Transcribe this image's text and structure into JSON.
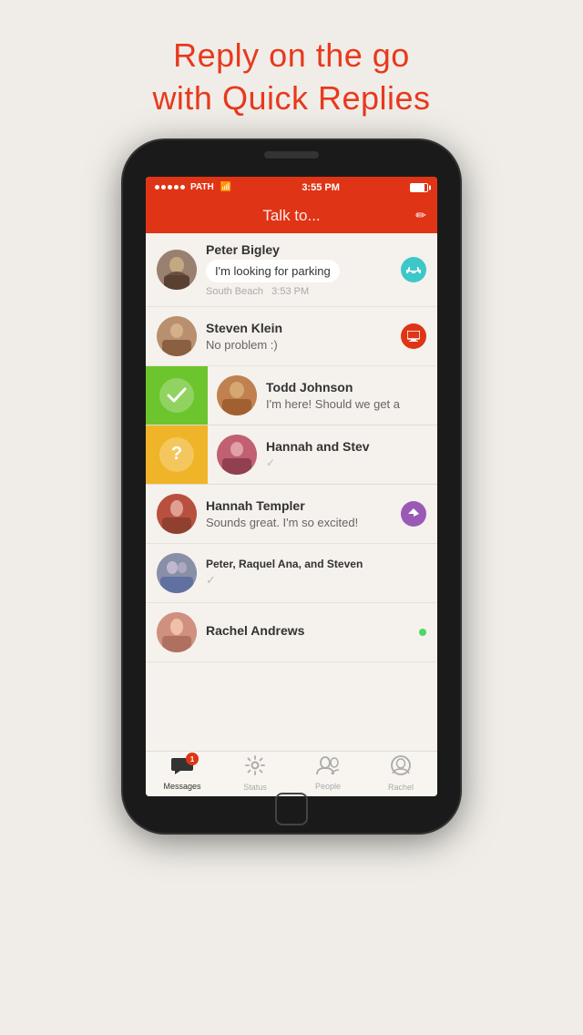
{
  "headline": {
    "line1": "Reply on the go",
    "line2": "with Quick Replies"
  },
  "status_bar": {
    "carrier": "PATH",
    "time": "3:55 PM"
  },
  "nav_bar": {
    "title": "Talk to...",
    "edit_icon": "✏"
  },
  "messages": [
    {
      "id": "peter-bigley",
      "sender": "Peter Bigley",
      "bubble": "I'm looking for parking",
      "sub": "South Beach  3:53 PM",
      "badge_type": "car",
      "badge_icon": "🚗",
      "avatar_color": "#9a8a7a",
      "action": null
    },
    {
      "id": "steven-klein",
      "sender": "Steven Klein",
      "preview": "No problem :)",
      "badge_type": "screen",
      "badge_icon": "⬜",
      "avatar_color": "#c4a882",
      "action": null
    },
    {
      "id": "todd-johnson",
      "sender": "Todd Johnson",
      "preview": "I'm here! Should we get a",
      "avatar_color": "#c88860",
      "action": "green",
      "action_icon": "✓"
    },
    {
      "id": "hannah-steve",
      "sender": "Hannah and Stev",
      "preview": "✓",
      "avatar_color": "#d06070",
      "action": "yellow",
      "action_icon": "?"
    },
    {
      "id": "hannah-templer",
      "sender": "Hannah Templer",
      "preview": "Sounds great. I'm so excited!",
      "badge_type": "nav",
      "badge_icon": "➤",
      "avatar_color": "#c85040",
      "action": null
    },
    {
      "id": "group-peter",
      "sender": "Peter, Raquel Ana, and Steven",
      "preview": "✓",
      "avatar_color": "#8890a8",
      "action": null
    },
    {
      "id": "rachel-andrews",
      "sender": "Rachel Andrews",
      "preview": "",
      "online": true,
      "avatar_color": "#d49080",
      "action": null
    }
  ],
  "tabs": [
    {
      "id": "messages",
      "label": "Messages",
      "icon": "💬",
      "active": true,
      "badge": "1"
    },
    {
      "id": "status",
      "label": "Status",
      "icon": "⚙",
      "active": false,
      "badge": null
    },
    {
      "id": "people",
      "label": "People",
      "icon": "👥",
      "active": false,
      "badge": null
    },
    {
      "id": "rachel",
      "label": "Rachel",
      "icon": "👤",
      "active": false,
      "badge": null
    }
  ]
}
